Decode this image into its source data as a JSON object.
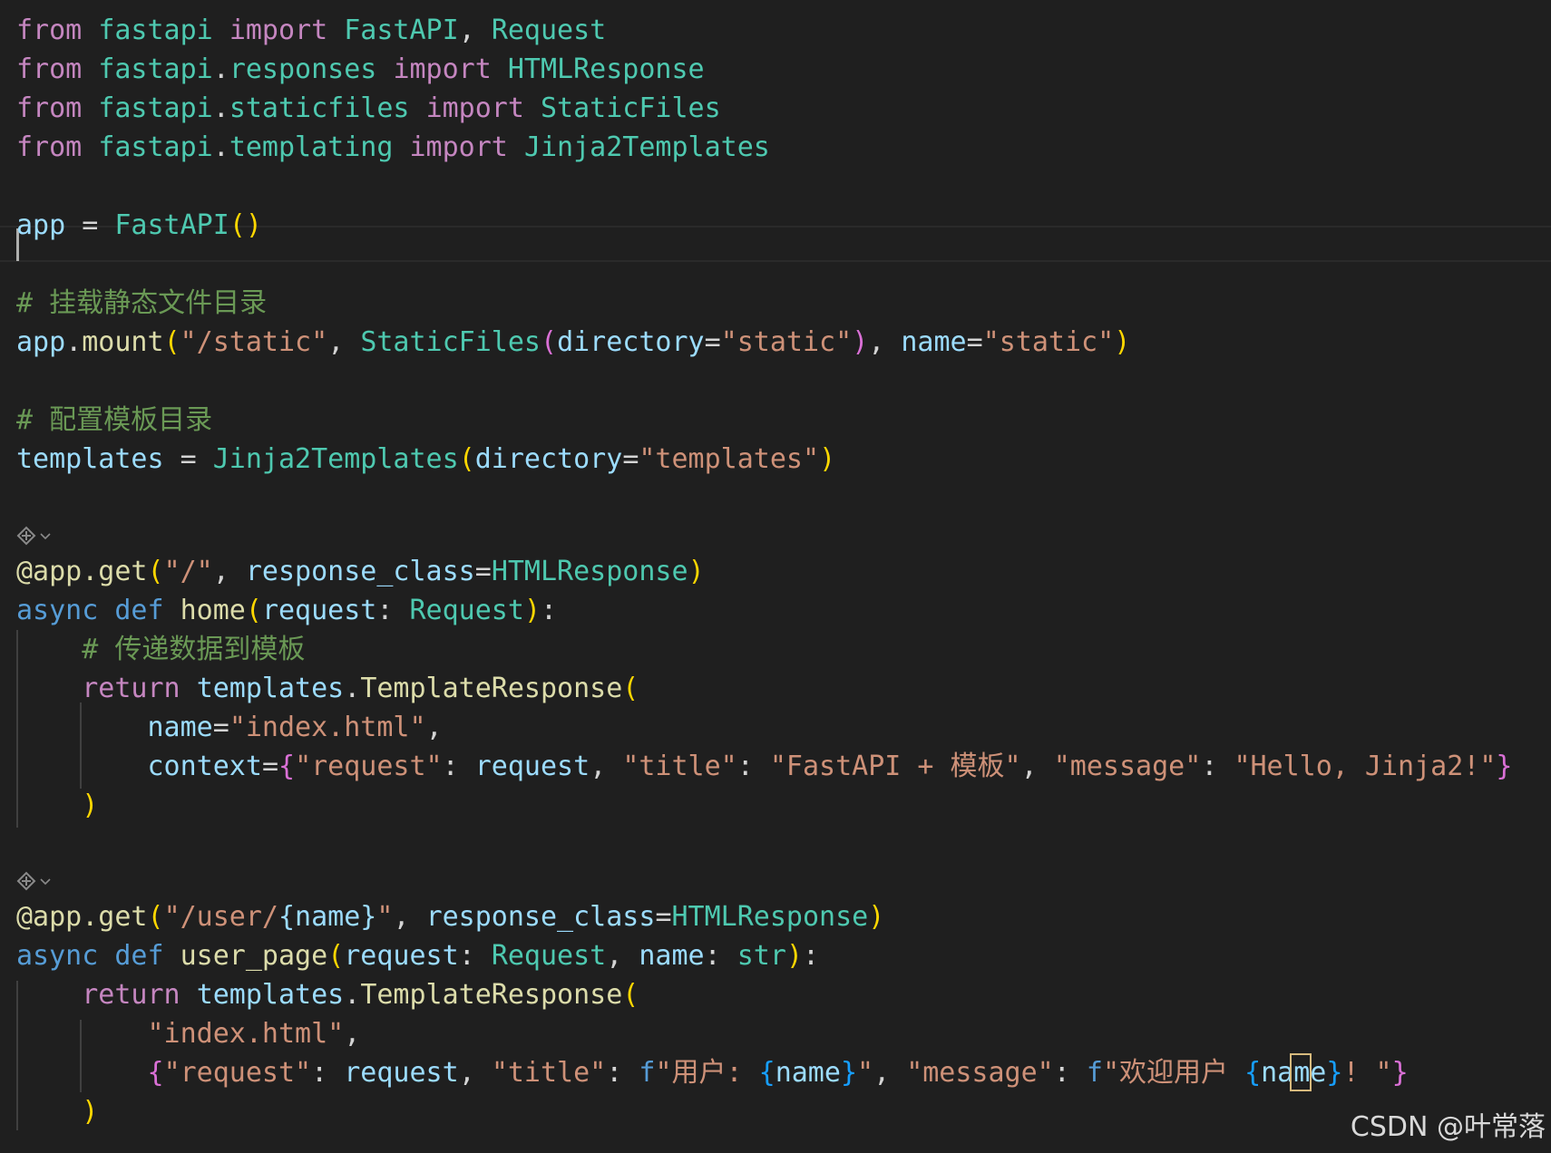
{
  "editor": {
    "lines": [
      {
        "id": "imp1",
        "tokens": [
          {
            "t": "from",
            "c": "kw-import"
          },
          {
            "t": " ",
            "c": "plain"
          },
          {
            "t": "fastapi",
            "c": "mod"
          },
          {
            "t": " ",
            "c": "plain"
          },
          {
            "t": "import",
            "c": "kw-import"
          },
          {
            "t": " ",
            "c": "plain"
          },
          {
            "t": "FastAPI",
            "c": "cls"
          },
          {
            "t": ", ",
            "c": "plain"
          },
          {
            "t": "Request",
            "c": "cls"
          }
        ]
      },
      {
        "id": "imp2",
        "tokens": [
          {
            "t": "from",
            "c": "kw-import"
          },
          {
            "t": " ",
            "c": "plain"
          },
          {
            "t": "fastapi",
            "c": "mod"
          },
          {
            "t": ".",
            "c": "plain"
          },
          {
            "t": "responses",
            "c": "mod"
          },
          {
            "t": " ",
            "c": "plain"
          },
          {
            "t": "import",
            "c": "kw-import"
          },
          {
            "t": " ",
            "c": "plain"
          },
          {
            "t": "HTMLResponse",
            "c": "cls"
          }
        ]
      },
      {
        "id": "imp3",
        "tokens": [
          {
            "t": "from",
            "c": "kw-import"
          },
          {
            "t": " ",
            "c": "plain"
          },
          {
            "t": "fastapi",
            "c": "mod"
          },
          {
            "t": ".",
            "c": "plain"
          },
          {
            "t": "staticfiles",
            "c": "mod"
          },
          {
            "t": " ",
            "c": "plain"
          },
          {
            "t": "import",
            "c": "kw-import"
          },
          {
            "t": " ",
            "c": "plain"
          },
          {
            "t": "StaticFiles",
            "c": "cls"
          }
        ]
      },
      {
        "id": "imp4",
        "tokens": [
          {
            "t": "from",
            "c": "kw-import"
          },
          {
            "t": " ",
            "c": "plain"
          },
          {
            "t": "fastapi",
            "c": "mod"
          },
          {
            "t": ".",
            "c": "plain"
          },
          {
            "t": "templating",
            "c": "mod"
          },
          {
            "t": " ",
            "c": "plain"
          },
          {
            "t": "import",
            "c": "kw-import"
          },
          {
            "t": " ",
            "c": "plain"
          },
          {
            "t": "Jinja2Templates",
            "c": "cls"
          }
        ]
      },
      {
        "id": "app",
        "tokens": [
          {
            "t": "app",
            "c": "var"
          },
          {
            "t": " = ",
            "c": "op"
          },
          {
            "t": "FastAPI",
            "c": "cls"
          },
          {
            "t": "()",
            "c": "p1"
          }
        ]
      },
      {
        "id": "cmt1",
        "tokens": [
          {
            "t": "# 挂载静态文件目录",
            "c": "cmt"
          }
        ]
      },
      {
        "id": "mount",
        "tokens": [
          {
            "t": "app",
            "c": "var"
          },
          {
            "t": ".",
            "c": "plain"
          },
          {
            "t": "mount",
            "c": "fn"
          },
          {
            "t": "(",
            "c": "p1"
          },
          {
            "t": "\"/static\"",
            "c": "str"
          },
          {
            "t": ", ",
            "c": "plain"
          },
          {
            "t": "StaticFiles",
            "c": "cls"
          },
          {
            "t": "(",
            "c": "p2"
          },
          {
            "t": "directory",
            "c": "var"
          },
          {
            "t": "=",
            "c": "op"
          },
          {
            "t": "\"static\"",
            "c": "str"
          },
          {
            "t": ")",
            "c": "p2"
          },
          {
            "t": ", ",
            "c": "plain"
          },
          {
            "t": "name",
            "c": "var"
          },
          {
            "t": "=",
            "c": "op"
          },
          {
            "t": "\"static\"",
            "c": "str"
          },
          {
            "t": ")",
            "c": "p1"
          }
        ]
      },
      {
        "id": "cmt2",
        "tokens": [
          {
            "t": "# 配置模板目录",
            "c": "cmt"
          }
        ]
      },
      {
        "id": "tpl",
        "tokens": [
          {
            "t": "templates",
            "c": "var"
          },
          {
            "t": " = ",
            "c": "op"
          },
          {
            "t": "Jinja2Templates",
            "c": "cls"
          },
          {
            "t": "(",
            "c": "p1"
          },
          {
            "t": "directory",
            "c": "var"
          },
          {
            "t": "=",
            "c": "op"
          },
          {
            "t": "\"templates\"",
            "c": "str"
          },
          {
            "t": ")",
            "c": "p1"
          }
        ]
      },
      {
        "id": "dec1",
        "tokens": [
          {
            "t": "@app.get",
            "c": "fn"
          },
          {
            "t": "(",
            "c": "p1"
          },
          {
            "t": "\"/\"",
            "c": "str"
          },
          {
            "t": ", ",
            "c": "plain"
          },
          {
            "t": "response_class",
            "c": "var"
          },
          {
            "t": "=",
            "c": "op"
          },
          {
            "t": "HTMLResponse",
            "c": "cls"
          },
          {
            "t": ")",
            "c": "p1"
          }
        ]
      },
      {
        "id": "def1",
        "tokens": [
          {
            "t": "async",
            "c": "kw"
          },
          {
            "t": " ",
            "c": "plain"
          },
          {
            "t": "def",
            "c": "kw"
          },
          {
            "t": " ",
            "c": "plain"
          },
          {
            "t": "home",
            "c": "fn"
          },
          {
            "t": "(",
            "c": "p1"
          },
          {
            "t": "request",
            "c": "var"
          },
          {
            "t": ": ",
            "c": "plain"
          },
          {
            "t": "Request",
            "c": "cls"
          },
          {
            "t": ")",
            "c": "p1"
          },
          {
            "t": ":",
            "c": "plain"
          }
        ]
      },
      {
        "id": "cmt3",
        "tokens": [
          {
            "t": "    ",
            "c": "plain"
          },
          {
            "t": "# 传递数据到模板",
            "c": "cmt"
          }
        ]
      },
      {
        "id": "ret1",
        "tokens": [
          {
            "t": "    ",
            "c": "plain"
          },
          {
            "t": "return",
            "c": "kw-ctrl"
          },
          {
            "t": " ",
            "c": "plain"
          },
          {
            "t": "templates",
            "c": "var"
          },
          {
            "t": ".",
            "c": "plain"
          },
          {
            "t": "TemplateResponse",
            "c": "fn"
          },
          {
            "t": "(",
            "c": "p1"
          }
        ]
      },
      {
        "id": "arg1",
        "tokens": [
          {
            "t": "        ",
            "c": "plain"
          },
          {
            "t": "name",
            "c": "var"
          },
          {
            "t": "=",
            "c": "op"
          },
          {
            "t": "\"index.html\"",
            "c": "str"
          },
          {
            "t": ",",
            "c": "plain"
          }
        ]
      },
      {
        "id": "ctx1",
        "tokens": [
          {
            "t": "        ",
            "c": "plain"
          },
          {
            "t": "context",
            "c": "var"
          },
          {
            "t": "=",
            "c": "op"
          },
          {
            "t": "{",
            "c": "p2"
          },
          {
            "t": "\"request\"",
            "c": "str"
          },
          {
            "t": ": ",
            "c": "plain"
          },
          {
            "t": "request",
            "c": "var"
          },
          {
            "t": ", ",
            "c": "plain"
          },
          {
            "t": "\"title\"",
            "c": "str"
          },
          {
            "t": ": ",
            "c": "plain"
          },
          {
            "t": "\"FastAPI + 模板\"",
            "c": "str"
          },
          {
            "t": ", ",
            "c": "plain"
          },
          {
            "t": "\"message\"",
            "c": "str"
          },
          {
            "t": ": ",
            "c": "plain"
          },
          {
            "t": "\"Hello, Jinja2!\"",
            "c": "str"
          },
          {
            "t": "}",
            "c": "p2"
          }
        ]
      },
      {
        "id": "close1",
        "tokens": [
          {
            "t": "    ",
            "c": "plain"
          },
          {
            "t": ")",
            "c": "p1"
          }
        ]
      },
      {
        "id": "dec2",
        "tokens": [
          {
            "t": "@app.get",
            "c": "fn"
          },
          {
            "t": "(",
            "c": "p1"
          },
          {
            "t": "\"/user/",
            "c": "str"
          },
          {
            "t": "{name}",
            "c": "var"
          },
          {
            "t": "\"",
            "c": "str"
          },
          {
            "t": ", ",
            "c": "plain"
          },
          {
            "t": "response_class",
            "c": "var"
          },
          {
            "t": "=",
            "c": "op"
          },
          {
            "t": "HTMLResponse",
            "c": "cls"
          },
          {
            "t": ")",
            "c": "p1"
          }
        ]
      },
      {
        "id": "def2",
        "tokens": [
          {
            "t": "async",
            "c": "kw"
          },
          {
            "t": " ",
            "c": "plain"
          },
          {
            "t": "def",
            "c": "kw"
          },
          {
            "t": " ",
            "c": "plain"
          },
          {
            "t": "user_page",
            "c": "fn"
          },
          {
            "t": "(",
            "c": "p1"
          },
          {
            "t": "request",
            "c": "var"
          },
          {
            "t": ": ",
            "c": "plain"
          },
          {
            "t": "Request",
            "c": "cls"
          },
          {
            "t": ", ",
            "c": "plain"
          },
          {
            "t": "name",
            "c": "var"
          },
          {
            "t": ": ",
            "c": "plain"
          },
          {
            "t": "str",
            "c": "cls"
          },
          {
            "t": ")",
            "c": "p1"
          },
          {
            "t": ":",
            "c": "plain"
          }
        ]
      },
      {
        "id": "ret2",
        "tokens": [
          {
            "t": "    ",
            "c": "plain"
          },
          {
            "t": "return",
            "c": "kw-ctrl"
          },
          {
            "t": " ",
            "c": "plain"
          },
          {
            "t": "templates",
            "c": "var"
          },
          {
            "t": ".",
            "c": "plain"
          },
          {
            "t": "TemplateResponse",
            "c": "fn"
          },
          {
            "t": "(",
            "c": "p1"
          }
        ]
      },
      {
        "id": "arg2",
        "tokens": [
          {
            "t": "        ",
            "c": "plain"
          },
          {
            "t": "\"index.html\"",
            "c": "str"
          },
          {
            "t": ",",
            "c": "plain"
          }
        ]
      },
      {
        "id": "ctx2",
        "tokens": [
          {
            "t": "        ",
            "c": "plain"
          },
          {
            "t": "{",
            "c": "p2"
          },
          {
            "t": "\"request\"",
            "c": "str"
          },
          {
            "t": ": ",
            "c": "plain"
          },
          {
            "t": "request",
            "c": "var"
          },
          {
            "t": ", ",
            "c": "plain"
          },
          {
            "t": "\"title\"",
            "c": "str"
          },
          {
            "t": ": ",
            "c": "plain"
          },
          {
            "t": "f",
            "c": "kw"
          },
          {
            "t": "\"用户: ",
            "c": "str"
          },
          {
            "t": "{",
            "c": "p3"
          },
          {
            "t": "name",
            "c": "var"
          },
          {
            "t": "}",
            "c": "p3"
          },
          {
            "t": "\"",
            "c": "str"
          },
          {
            "t": ", ",
            "c": "plain"
          },
          {
            "t": "\"message\"",
            "c": "str"
          },
          {
            "t": ": ",
            "c": "plain"
          },
          {
            "t": "f",
            "c": "kw"
          },
          {
            "t": "\"欢迎用户 ",
            "c": "str"
          },
          {
            "t": "{",
            "c": "p3"
          },
          {
            "t": "name",
            "c": "var"
          },
          {
            "t": "}",
            "c": "p3"
          },
          {
            "t": "! \"",
            "c": "str"
          },
          {
            "t": "}",
            "c": "p2"
          }
        ]
      },
      {
        "id": "close2",
        "tokens": [
          {
            "t": "    ",
            "c": "plain"
          },
          {
            "t": ")",
            "c": "p1"
          }
        ]
      }
    ]
  },
  "watermark": "CSDN @叶常落"
}
